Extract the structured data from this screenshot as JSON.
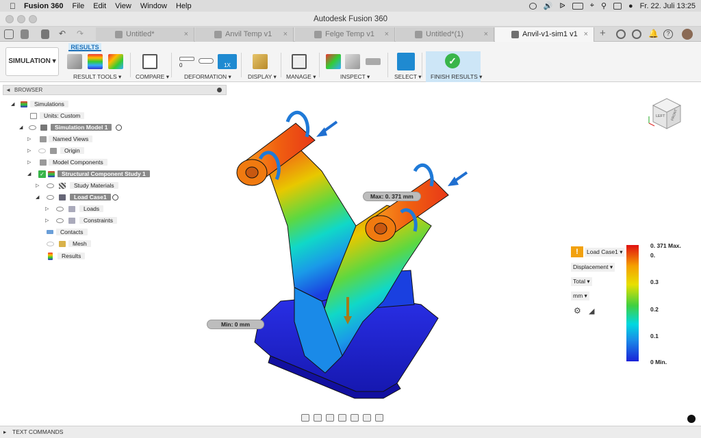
{
  "menubar": {
    "app_name": "Fusion 360",
    "items": [
      "File",
      "Edit",
      "View",
      "Window",
      "Help"
    ],
    "clock": "Fr. 22. Juli  13:25"
  },
  "window": {
    "title": "Autodesk Fusion 360"
  },
  "tabs": [
    {
      "label": "Untitled*",
      "active": false
    },
    {
      "label": "Anvil Temp v1",
      "active": false
    },
    {
      "label": "Felge Temp v1",
      "active": false
    },
    {
      "label": "Untitled*(1)",
      "active": false
    },
    {
      "label": "Anvil-v1-sim1 v1",
      "active": true
    }
  ],
  "ribbon": {
    "workspace": "SIMULATION ▾",
    "active_tab": "RESULTS",
    "deformation_scale": "1X",
    "deformation_zero": "0",
    "groups": [
      "RESULT TOOLS ▾",
      "COMPARE ▾",
      "DEFORMATION ▾",
      "DISPLAY ▾",
      "MANAGE ▾",
      "INSPECT ▾",
      "SELECT ▾",
      "FINISH RESULTS ▾"
    ]
  },
  "browser": {
    "title": "BROWSER",
    "items": [
      {
        "label": "Simulations"
      },
      {
        "label": "Units: Custom"
      },
      {
        "label": "Simulation Model 1"
      },
      {
        "label": "Named Views"
      },
      {
        "label": "Origin"
      },
      {
        "label": "Model Components"
      },
      {
        "label": "Structural Component Study 1"
      },
      {
        "label": "Study Materials"
      },
      {
        "label": "Load Case1"
      },
      {
        "label": "Loads"
      },
      {
        "label": "Constraints"
      },
      {
        "label": "Contacts"
      },
      {
        "label": "Mesh"
      },
      {
        "label": "Results"
      }
    ]
  },
  "viewcube": {
    "left": "LEFT",
    "front": "FRONT"
  },
  "callouts": {
    "max": "Max: 0.  371 mm",
    "min": "Min: 0 mm"
  },
  "legend": {
    "load_case": "Load Case1 ▾",
    "result_type": "Displacement  ▾",
    "component": "Total ▾",
    "unit": "mm  ▾",
    "values": [
      "0.  371 Max.",
      "0.",
      "0.3",
      "0.2",
      "0.1",
      "0 Min."
    ]
  },
  "text_commands": "TEXT COMMANDS"
}
